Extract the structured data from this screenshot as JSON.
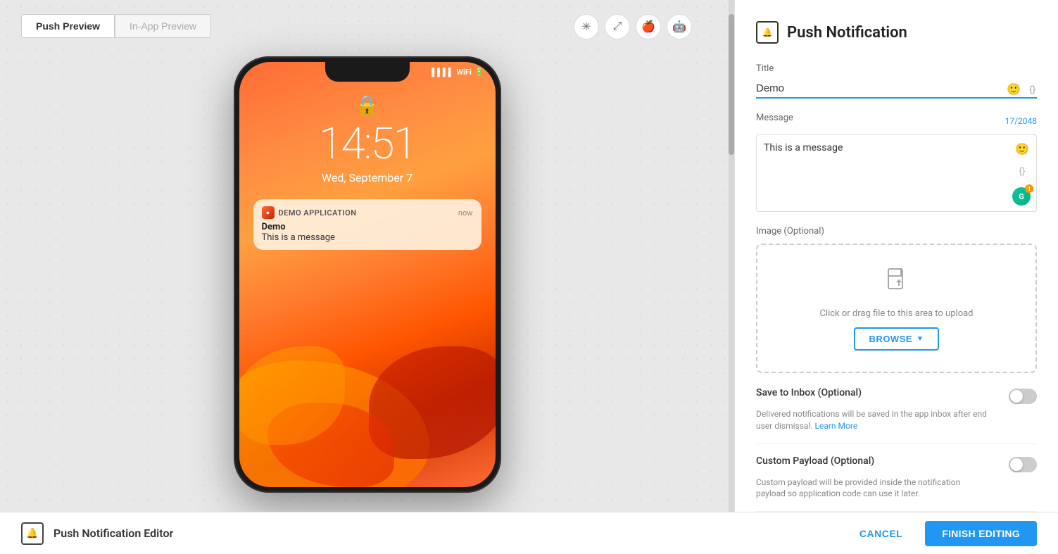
{
  "preview": {
    "tab_push": "Push Preview",
    "tab_inapp": "In-App Preview",
    "icons": {
      "pin": "⚲",
      "expand": "⤢",
      "apple": "",
      "android": ""
    },
    "phone": {
      "time": "14:51",
      "date": "Wed, September 7",
      "notification": {
        "app_name": "DEMO APPLICATION",
        "time_label": "now",
        "title": "Demo",
        "message": "This is a message"
      }
    }
  },
  "panel": {
    "title": "Push Notification",
    "title_field_label": "Title",
    "title_value": "Demo",
    "message_field_label": "Message",
    "message_value": "This is a message",
    "char_count": "17/2048",
    "image_label": "Image (Optional)",
    "upload_text": "Click or drag file to this area to upload",
    "browse_label": "BROWSE",
    "save_inbox_label": "Save to Inbox (Optional)",
    "save_inbox_desc": "Delivered notifications will be saved in the app inbox after end user dismissal.",
    "learn_more": "Learn More",
    "custom_payload_label": "Custom Payload (Optional)",
    "custom_payload_desc": "Custom payload will be provided inside the notification payload so application code can use it later."
  },
  "footer": {
    "editor_title": "Push Notification Editor",
    "cancel_label": "CANCEL",
    "finish_label": "FINISH EDITING"
  }
}
